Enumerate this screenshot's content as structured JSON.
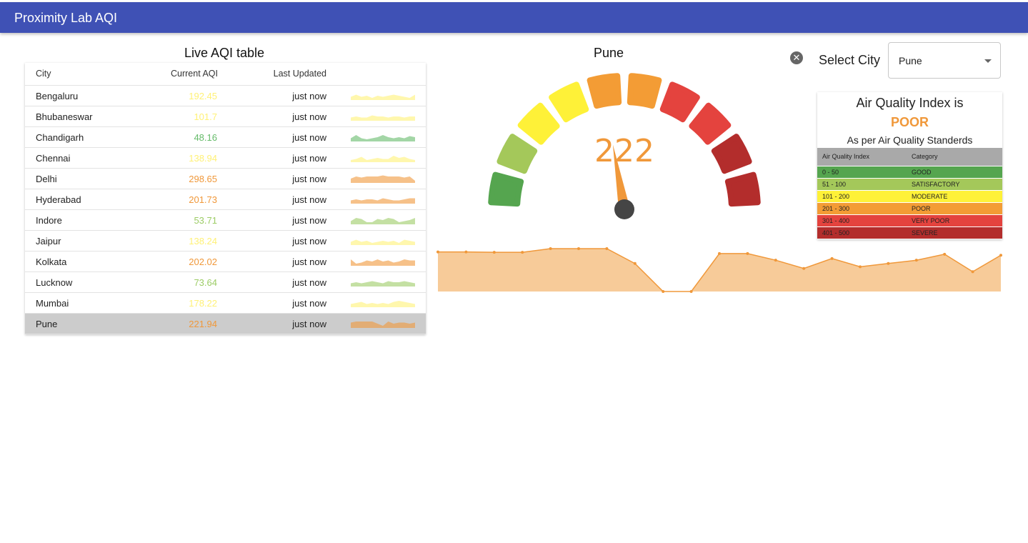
{
  "app": {
    "title": "Proximity Lab AQI"
  },
  "table": {
    "title": "Live AQI table",
    "headers": {
      "city": "City",
      "aqi": "Current AQI",
      "updated": "Last Updated"
    },
    "rows": [
      {
        "city": "Bengaluru",
        "aqi": "192.45",
        "updated": "just now",
        "color": "#fff176",
        "spark": [
          3,
          5,
          3,
          4,
          2,
          4,
          3,
          4,
          5,
          4,
          3,
          2,
          5
        ]
      },
      {
        "city": "Bhubaneswar",
        "aqi": "101.7",
        "updated": "just now",
        "color": "#fff176",
        "spark": [
          3,
          4,
          3,
          3,
          5,
          4,
          4,
          3,
          4,
          4,
          3,
          4,
          4
        ]
      },
      {
        "city": "Chandigarh",
        "aqi": "48.16",
        "updated": "just now",
        "color": "#66bb6a",
        "spark": [
          3,
          6,
          3,
          2,
          3,
          4,
          6,
          4,
          3,
          4,
          3,
          5,
          4
        ]
      },
      {
        "city": "Chennai",
        "aqi": "138.94",
        "updated": "just now",
        "color": "#fff176",
        "spark": [
          2,
          3,
          5,
          2,
          3,
          4,
          3,
          3,
          6,
          4,
          5,
          3,
          2
        ]
      },
      {
        "city": "Delhi",
        "aqi": "298.65",
        "updated": "just now",
        "color": "#f0983a",
        "spark": [
          4,
          6,
          5,
          6,
          6,
          6,
          7,
          6,
          6,
          6,
          5,
          6,
          2
        ]
      },
      {
        "city": "Hyderabad",
        "aqi": "201.73",
        "updated": "just now",
        "color": "#f0983a",
        "spark": [
          3,
          4,
          3,
          4,
          4,
          3,
          5,
          4,
          3,
          3,
          4,
          5,
          5
        ]
      },
      {
        "city": "Indore",
        "aqi": "53.71",
        "updated": "just now",
        "color": "#9ccc65",
        "spark": [
          3,
          6,
          5,
          2,
          2,
          5,
          4,
          6,
          5,
          2,
          3,
          4,
          6
        ]
      },
      {
        "city": "Jaipur",
        "aqi": "138.24",
        "updated": "just now",
        "color": "#fff176",
        "spark": [
          3,
          5,
          3,
          4,
          2,
          3,
          4,
          3,
          4,
          2,
          5,
          4,
          3
        ]
      },
      {
        "city": "Kolkata",
        "aqi": "202.02",
        "updated": "just now",
        "color": "#f0983a",
        "spark": [
          6,
          2,
          3,
          5,
          4,
          6,
          4,
          5,
          3,
          4,
          6,
          5,
          5
        ]
      },
      {
        "city": "Lucknow",
        "aqi": "73.64",
        "updated": "just now",
        "color": "#9ccc65",
        "spark": [
          3,
          4,
          3,
          4,
          5,
          4,
          3,
          5,
          4,
          4,
          5,
          4,
          3
        ]
      },
      {
        "city": "Mumbai",
        "aqi": "178.22",
        "updated": "just now",
        "color": "#fff176",
        "spark": [
          3,
          4,
          5,
          3,
          4,
          3,
          4,
          3,
          5,
          6,
          5,
          4,
          3
        ]
      },
      {
        "city": "Pune",
        "aqi": "221.94",
        "updated": "just now",
        "color": "#f0983a",
        "spark": [
          5,
          6,
          6,
          6,
          6,
          4,
          2,
          6,
          4,
          5,
          5,
          4,
          5
        ]
      }
    ],
    "selected_index": 11
  },
  "city_view": {
    "title": "Pune",
    "gauge": {
      "value": "222",
      "min": 0,
      "max": 500,
      "value_color": "#f0983a",
      "needle_color": "#f0983a",
      "hub_color": "#454545"
    },
    "segment_colors": [
      "#55a54f",
      "#a4c85a",
      "#fef138",
      "#fef138",
      "#f39c35",
      "#f39c35",
      "#e4433e",
      "#e4433e",
      "#b32d2c",
      "#b32d2c"
    ]
  },
  "chart_data": {
    "type": "area",
    "color": "#f0983a",
    "fill": "#f7cb99",
    "values": [
      225,
      225,
      224,
      224,
      235,
      235,
      235,
      190,
      105,
      105,
      220,
      220,
      200,
      175,
      205,
      180,
      190,
      200,
      218,
      165,
      215
    ]
  },
  "select": {
    "label": "Select City",
    "value": "Pune",
    "clear_icon": "close-circle-icon"
  },
  "aqi_card": {
    "title": "Air Quality Index is",
    "status": "POOR",
    "status_color": "#f0983a",
    "subtitle": "As per Air Quality Standerds",
    "headers": {
      "range": "Air Quality Index",
      "category": "Category"
    },
    "legend": [
      {
        "range": "0 - 50",
        "category": "GOOD",
        "color": "#55a54f"
      },
      {
        "range": "51 - 100",
        "category": "SATISFACTORY",
        "color": "#a4c85a"
      },
      {
        "range": "101 - 200",
        "category": "MODERATE",
        "color": "#fef138"
      },
      {
        "range": "201 - 300",
        "category": "POOR",
        "color": "#f39c35"
      },
      {
        "range": "301 - 400",
        "category": "VERY POOR",
        "color": "#e4433e"
      },
      {
        "range": "401 - 500",
        "category": "SEVERE",
        "color": "#b32d2c"
      }
    ]
  }
}
